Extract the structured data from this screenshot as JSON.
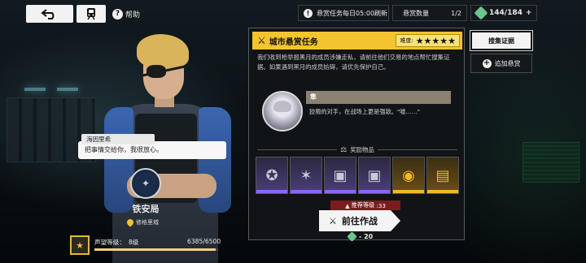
{
  "topbar": {
    "back_icon": "back-arrow-icon",
    "home_icon": "train-icon",
    "help_label": "帮助",
    "refresh_notice": "悬赏任务每日05:00刷新",
    "count_label": "悬赏数量",
    "count_value": "1/2",
    "stamina_value": "144/184",
    "stamina_plus": "+"
  },
  "task": {
    "title": "城市悬赏任务",
    "difficulty_label": "难度:",
    "difficulty_stars": 5,
    "difficulty_display": "★★★★★",
    "description": "我们收到枪举报黑月的成员涉嫌走私，请前往他们交易的地点帮忙搜集证据。如果遇到黑月的成员妨碍，请优先保护自己。",
    "npc": {
      "name": "隼",
      "quote": "狡猾的对手，在战场上更是强敌。\"嘘……\""
    },
    "rewards_label": "奖励物品",
    "rewards": [
      {
        "icon": "medal-icon",
        "glyph": "✪",
        "rarity": "rare",
        "count": ""
      },
      {
        "icon": "badge-icon",
        "glyph": "✶",
        "rarity": "rare",
        "count": ""
      },
      {
        "icon": "metal-case-icon",
        "glyph": "▣",
        "rarity": "rare",
        "count": ""
      },
      {
        "icon": "metal-case-icon",
        "glyph": "▣",
        "rarity": "rare",
        "count": ""
      },
      {
        "icon": "gold-helmet-icon",
        "glyph": "◉",
        "rarity": "legend",
        "count": ""
      },
      {
        "icon": "gold-case-icon",
        "glyph": "▤",
        "rarity": "legend",
        "count": ""
      }
    ],
    "recommend_label": "推荐等级",
    "recommend_level": ":33",
    "go_label": "前往作战",
    "cost": "- 20"
  },
  "side": {
    "collect_label": "搜集证据",
    "add_label": "追加悬赏"
  },
  "dialogue": {
    "speaker": "海因里希",
    "line": "把事情交给你，我很放心。"
  },
  "faction": {
    "name": "铁安局",
    "location": "修格里城"
  },
  "reputation": {
    "label": "声望等级：",
    "level": "8级",
    "value": "6385/6500",
    "progress": 0.982
  },
  "colors": {
    "accent": "#f3c42f",
    "rare": "#8a66ff",
    "legend": "#f2b825",
    "stamina": "#6bc58a"
  }
}
